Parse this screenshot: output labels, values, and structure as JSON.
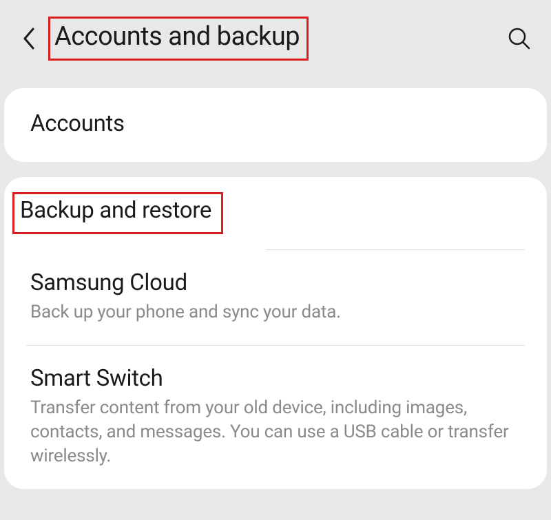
{
  "header": {
    "title": "Accounts and backup"
  },
  "card1": {
    "items": [
      {
        "title": "Accounts"
      }
    ]
  },
  "card2": {
    "sectionHeader": "Backup and restore",
    "items": [
      {
        "title": "Samsung Cloud",
        "subtitle": "Back up your phone and sync your data."
      },
      {
        "title": "Smart Switch",
        "subtitle": "Transfer content from your old device, including images, contacts, and messages. You can use a USB cable or transfer wirelessly."
      }
    ]
  }
}
